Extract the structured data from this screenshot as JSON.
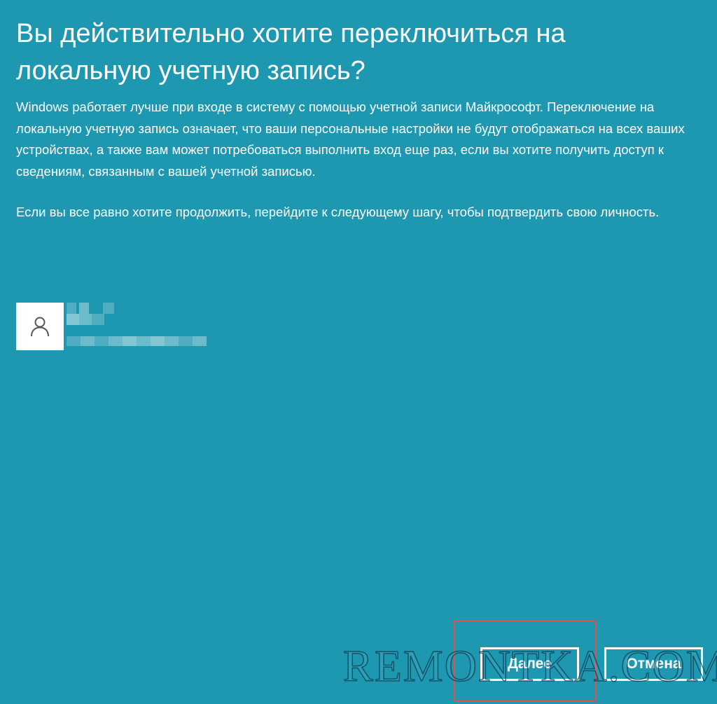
{
  "dialog": {
    "title": "Вы действительно хотите переключиться на локальную учетную запись?",
    "paragraph1": "Windows работает лучше при входе в систему с помощью учетной записи Майкрософт. Переключение на локальную учетную запись означает, что ваши персональные настройки не будут отображаться на всех ваших устройствах, а также вам может потребоваться выполнить вход еще раз, если вы хотите получить доступ к сведениям, связанным с вашей учетной записью.",
    "paragraph2": "Если вы все равно хотите продолжить, перейдите к следующему шагу, чтобы подтвердить свою личность."
  },
  "account": {
    "avatar_icon": "user-icon"
  },
  "buttons": {
    "next_label": "Далее",
    "cancel_label": "Отмена"
  },
  "watermark": "REMONTKA.COM",
  "colors": {
    "background": "#1e97b1",
    "text": "#ffffff",
    "highlight": "#e0504d"
  }
}
